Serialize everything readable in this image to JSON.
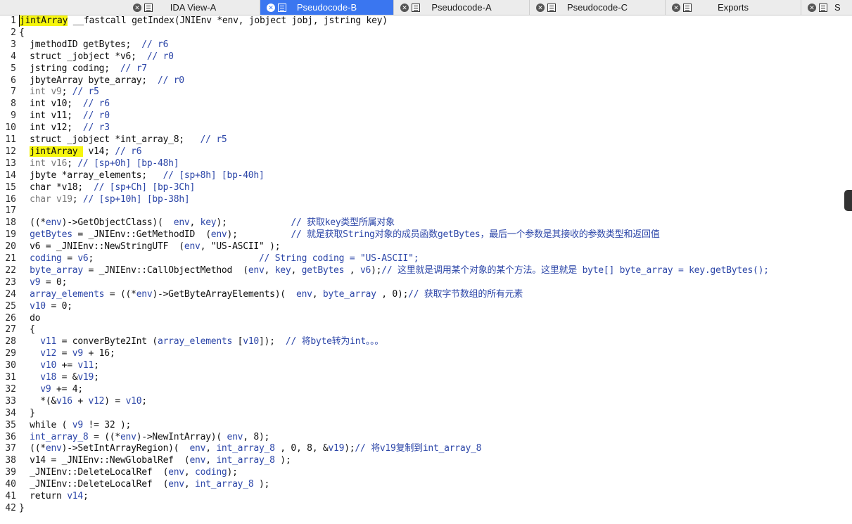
{
  "tabs": [
    {
      "label": "IDA View-A",
      "active": false
    },
    {
      "label": "Pseudocode-B",
      "active": true
    },
    {
      "label": "Pseudocode-A",
      "active": false
    },
    {
      "label": "Pseudocode-C",
      "active": false
    },
    {
      "label": "Exports",
      "active": false
    },
    {
      "label": "S",
      "active": false
    }
  ],
  "code_lines": [
    {
      "n": "1",
      "segs": [
        [
          "hl",
          "jintArray"
        ],
        [
          "",
          " __fastcall getIndex(JNIEnv *env, jobject jobj, jstring key)"
        ]
      ]
    },
    {
      "n": "2",
      "segs": [
        [
          "",
          "{"
        ]
      ]
    },
    {
      "n": "3",
      "segs": [
        [
          "",
          "  jmethodID getBytes;  "
        ],
        [
          "cmt",
          "// r6"
        ]
      ]
    },
    {
      "n": "4",
      "segs": [
        [
          "",
          "  struct _jobject *v6;  "
        ],
        [
          "cmt",
          "// r0"
        ]
      ]
    },
    {
      "n": "5",
      "segs": [
        [
          "",
          "  jstring coding;  "
        ],
        [
          "cmt",
          "// r7"
        ]
      ]
    },
    {
      "n": "6",
      "segs": [
        [
          "",
          "  jbyteArray byte_array;  "
        ],
        [
          "cmt",
          "// r0"
        ]
      ]
    },
    {
      "n": "7",
      "segs": [
        [
          "gray",
          "  int v9"
        ],
        [
          "",
          ";"
        ],
        [
          "cmt",
          " // r5"
        ]
      ]
    },
    {
      "n": "8",
      "segs": [
        [
          "",
          "  int v10;  "
        ],
        [
          "cmt",
          "// r6"
        ]
      ]
    },
    {
      "n": "9",
      "segs": [
        [
          "",
          "  int v11;  "
        ],
        [
          "cmt",
          "// r0"
        ]
      ]
    },
    {
      "n": "10",
      "segs": [
        [
          "",
          "  int v12;  "
        ],
        [
          "cmt",
          "// r3"
        ]
      ]
    },
    {
      "n": "11",
      "segs": [
        [
          "",
          "  struct _jobject *int_array_8;   "
        ],
        [
          "cmt",
          "// r5"
        ]
      ]
    },
    {
      "n": "12",
      "segs": [
        [
          "",
          "  "
        ],
        [
          "hl",
          "jintArray "
        ],
        [
          "",
          " v14; "
        ],
        [
          "cmt",
          "// r6"
        ]
      ]
    },
    {
      "n": "13",
      "segs": [
        [
          "gray",
          "  int v16"
        ],
        [
          "",
          ";"
        ],
        [
          "cmt",
          " // [sp+0h] [bp-48h]"
        ]
      ]
    },
    {
      "n": "14",
      "segs": [
        [
          "",
          "  jbyte *array_elements;   "
        ],
        [
          "cmt",
          "// [sp+8h] [bp-40h]"
        ]
      ]
    },
    {
      "n": "15",
      "segs": [
        [
          "",
          "  char *v18;  "
        ],
        [
          "cmt",
          "// [sp+Ch] [bp-3Ch]"
        ]
      ]
    },
    {
      "n": "16",
      "segs": [
        [
          "gray",
          "  char v19"
        ],
        [
          "",
          ";"
        ],
        [
          "cmt",
          " // [sp+10h] [bp-38h]"
        ]
      ]
    },
    {
      "n": "17",
      "segs": [
        [
          "",
          ""
        ]
      ]
    },
    {
      "n": "18",
      "segs": [
        [
          "",
          "  ((*"
        ],
        [
          "var",
          "env"
        ],
        [
          "",
          ")->GetObjectClass)(  "
        ],
        [
          "var",
          "env"
        ],
        [
          "",
          ", "
        ],
        [
          "var",
          "key"
        ],
        [
          "",
          ");            "
        ],
        [
          "cmt",
          "// 获取key类型所属对象"
        ]
      ]
    },
    {
      "n": "19",
      "segs": [
        [
          "var",
          "  getBytes"
        ],
        [
          "",
          " = _JNIEnv::GetMethodID  ("
        ],
        [
          "var",
          "env"
        ],
        [
          "",
          ");          "
        ],
        [
          "cmt",
          "// 就是获取String对象的成员函数getBytes，最后一个参数是其接收的参数类型和返回值"
        ]
      ]
    },
    {
      "n": "20",
      "segs": [
        [
          "",
          "  v6 = _JNIEnv::NewStringUTF  ("
        ],
        [
          "var",
          "env"
        ],
        [
          "",
          ", \"US-ASCII\" );"
        ]
      ]
    },
    {
      "n": "21",
      "segs": [
        [
          "var",
          "  coding"
        ],
        [
          "",
          " = "
        ],
        [
          "var",
          "v6"
        ],
        [
          "",
          ";                               "
        ],
        [
          "cmt",
          "// String coding = \"US-ASCII\";"
        ]
      ]
    },
    {
      "n": "22",
      "segs": [
        [
          "var",
          "  byte_array"
        ],
        [
          "",
          " = _JNIEnv::CallObjectMethod  ("
        ],
        [
          "var",
          "env"
        ],
        [
          "",
          ", "
        ],
        [
          "var",
          "key"
        ],
        [
          "",
          ", "
        ],
        [
          "var",
          "getBytes"
        ],
        [
          "",
          " , "
        ],
        [
          "var",
          "v6"
        ],
        [
          "",
          ");"
        ],
        [
          "cmt",
          "// 这里就是调用某个对象的某个方法。这里就是 byte[] byte_array = key.getBytes();"
        ]
      ]
    },
    {
      "n": "23",
      "segs": [
        [
          "var",
          "  v9"
        ],
        [
          "",
          " = 0;"
        ]
      ]
    },
    {
      "n": "24",
      "segs": [
        [
          "var",
          "  array_elements"
        ],
        [
          "",
          " = ((*"
        ],
        [
          "var",
          "env"
        ],
        [
          "",
          ")->GetByteArrayElements)(  "
        ],
        [
          "var",
          "env"
        ],
        [
          "",
          ", "
        ],
        [
          "var",
          "byte_array"
        ],
        [
          "",
          " , 0);"
        ],
        [
          "cmt",
          "// 获取字节数组的所有元素"
        ]
      ]
    },
    {
      "n": "25",
      "segs": [
        [
          "var",
          "  v10"
        ],
        [
          "",
          " = 0;"
        ]
      ]
    },
    {
      "n": "26",
      "segs": [
        [
          "",
          "  do"
        ]
      ]
    },
    {
      "n": "27",
      "segs": [
        [
          "",
          "  {"
        ]
      ]
    },
    {
      "n": "28",
      "segs": [
        [
          "var",
          "    v11"
        ],
        [
          "",
          " = converByte2Int ("
        ],
        [
          "var",
          "array_elements"
        ],
        [
          "",
          " ["
        ],
        [
          "var",
          "v10"
        ],
        [
          "",
          "]);  "
        ],
        [
          "cmt",
          "// 将byte转为int。。。"
        ]
      ]
    },
    {
      "n": "29",
      "segs": [
        [
          "var",
          "    v12"
        ],
        [
          "",
          " = "
        ],
        [
          "var",
          "v9"
        ],
        [
          "",
          " + 16;"
        ]
      ]
    },
    {
      "n": "30",
      "segs": [
        [
          "var",
          "    v10"
        ],
        [
          "",
          " += "
        ],
        [
          "var",
          "v11"
        ],
        [
          "",
          ";"
        ]
      ]
    },
    {
      "n": "31",
      "segs": [
        [
          "var",
          "    v18"
        ],
        [
          "",
          " = &"
        ],
        [
          "var",
          "v19"
        ],
        [
          "",
          ";"
        ]
      ]
    },
    {
      "n": "32",
      "segs": [
        [
          "var",
          "    v9"
        ],
        [
          "",
          " += 4;"
        ]
      ]
    },
    {
      "n": "33",
      "segs": [
        [
          "",
          "    *(&"
        ],
        [
          "var",
          "v16"
        ],
        [
          "",
          " + "
        ],
        [
          "var",
          "v12"
        ],
        [
          "",
          ") = "
        ],
        [
          "var",
          "v10"
        ],
        [
          "",
          ";"
        ]
      ]
    },
    {
      "n": "34",
      "segs": [
        [
          "",
          "  }"
        ]
      ]
    },
    {
      "n": "35",
      "segs": [
        [
          "",
          "  while ( "
        ],
        [
          "var",
          "v9"
        ],
        [
          "",
          " != 32 );"
        ]
      ]
    },
    {
      "n": "36",
      "segs": [
        [
          "var",
          "  int_array_8"
        ],
        [
          "",
          " = ((*"
        ],
        [
          "var",
          "env"
        ],
        [
          "",
          ")->NewIntArray)( "
        ],
        [
          "var",
          "env"
        ],
        [
          "",
          ", 8);"
        ]
      ]
    },
    {
      "n": "37",
      "segs": [
        [
          "",
          "  ((*"
        ],
        [
          "var",
          "env"
        ],
        [
          "",
          ")->SetIntArrayRegion)(  "
        ],
        [
          "var",
          "env"
        ],
        [
          "",
          ", "
        ],
        [
          "var",
          "int_array_8"
        ],
        [
          "",
          " , 0, 8, &"
        ],
        [
          "var",
          "v19"
        ],
        [
          "",
          ");"
        ],
        [
          "cmt",
          "// 将v19复制到int_array_8"
        ]
      ]
    },
    {
      "n": "38",
      "segs": [
        [
          "",
          "  v14 = _JNIEnv::NewGlobalRef  ("
        ],
        [
          "var",
          "env"
        ],
        [
          "",
          ", "
        ],
        [
          "var",
          "int_array_8"
        ],
        [
          "",
          " );"
        ]
      ]
    },
    {
      "n": "39",
      "segs": [
        [
          "",
          "  _JNIEnv::DeleteLocalRef  ("
        ],
        [
          "var",
          "env"
        ],
        [
          "",
          ", "
        ],
        [
          "var",
          "coding"
        ],
        [
          "",
          ");"
        ]
      ]
    },
    {
      "n": "40",
      "segs": [
        [
          "",
          "  _JNIEnv::DeleteLocalRef  ("
        ],
        [
          "var",
          "env"
        ],
        [
          "",
          ", "
        ],
        [
          "var",
          "int_array_8"
        ],
        [
          "",
          " );"
        ]
      ]
    },
    {
      "n": "41",
      "segs": [
        [
          "",
          "  return "
        ],
        [
          "var",
          "v14"
        ],
        [
          "",
          ";"
        ]
      ]
    },
    {
      "n": "42",
      "segs": [
        [
          "",
          "}"
        ]
      ]
    }
  ]
}
